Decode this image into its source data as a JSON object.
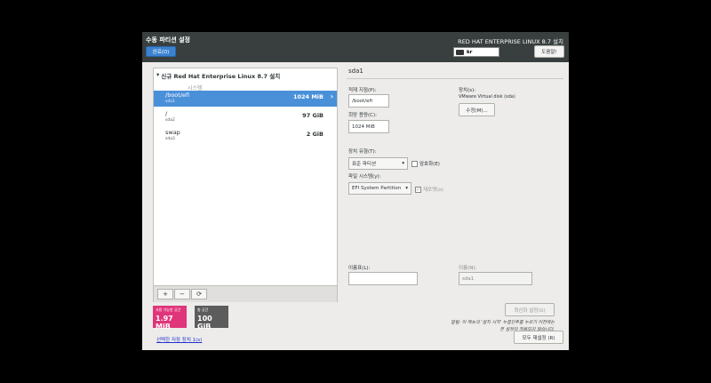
{
  "header": {
    "title": "수동 파티션 설정",
    "done_label": "완료(D)",
    "product": "RED HAT ENTERPRISE LINUX 8.7 설치",
    "keyboard": "kr",
    "help_label": "도움말!"
  },
  "left": {
    "install_title": "신규 Red Hat Enterprise Linux 8.7 설치",
    "system_label": "시스템",
    "partitions": [
      {
        "mount": "/boot/efi",
        "device": "sda1",
        "size": "1024 MiB",
        "selected": true
      },
      {
        "mount": "/",
        "device": "sda2",
        "size": "97 GiB",
        "selected": false
      },
      {
        "mount": "swap",
        "device": "sda3",
        "size": "2 GiB",
        "selected": false
      }
    ],
    "toolbar": {
      "add": "+",
      "remove": "−",
      "refresh": "⟳"
    }
  },
  "space": {
    "available_label": "사용 가능한 공간",
    "available_value": "1.97 MiB",
    "total_label": "총 공간",
    "total_value": "100 GiB"
  },
  "storage_link": "선택한 저장 장치 1(s)",
  "right": {
    "title": "sda1",
    "mount_label": "적재 지점(P):",
    "mount_value": "/boot/efi",
    "capacity_label": "희망 용량(C):",
    "capacity_value": "1024 MiB",
    "device_label": "장치(s):",
    "device_value": "VMware Virtual disk (sda)",
    "modify_label": "수정(M)...",
    "devtype_label": "장치 유형(T):",
    "devtype_value": "표준 파티션",
    "encrypt_label": "암호화(E)",
    "fs_label": "파일 시스템(y):",
    "fs_value": "EFI System Partition",
    "reformat_label": "재포맷(o)",
    "label_label": "이름표(L):",
    "label_value": "",
    "name_label": "이름(N):",
    "name_value": "sda1",
    "update_label": "최신화 설정(U)",
    "note_line1": "알림: 이 메뉴의 '설치 시작' 누름단추를 누르기 이전에는",
    "note_line2": "본 설정이 적용되지 않습니다."
  },
  "reset_label": "모두 재설정 (R)"
}
